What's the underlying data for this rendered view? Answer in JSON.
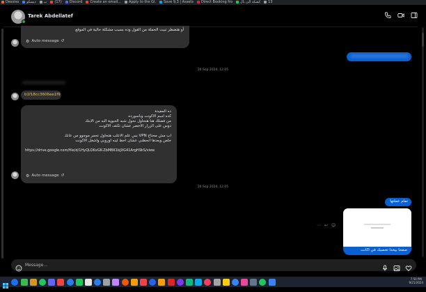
{
  "browser_tabs": [
    {
      "label": "Dessiso",
      "color": "#e36b2e"
    },
    {
      "label": "دیسکو",
      "color": "#3b82f6"
    },
    {
      "label": "ب",
      "color": "#9aa0a6"
    },
    {
      "label": "‏(17)",
      "color": "#ef4444"
    },
    {
      "label": "Discord",
      "color": "#5865f2"
    },
    {
      "label": "Create an email...",
      "color": "#ea4335"
    },
    {
      "label": "Apply to the Gi.",
      "color": "#9aa0a6"
    },
    {
      "label": "Save 9,3 | Assets",
      "color": "#0ea5e9"
    },
    {
      "label": "Direct Booking fro",
      "color": "#e11d48"
    },
    {
      "label": "كشكة الى نال",
      "color": "#22c55e"
    },
    {
      "label": "13",
      "color": "#9aa0a6"
    }
  ],
  "header": {
    "contact_name": "Tarek Abdellatef"
  },
  "messages": {
    "first_bubble_text": "أو هتضطر تبيت الحملة من القول وده بسبب مشكلة حالية في الموقع",
    "auto_message_label": "Auto message",
    "outgoing_blurred": "xxxxxxxxxxxxxxxxxxxxxxxxxxxxxxxxxxx",
    "timestamp_1": "20 Sep 2024, 12:05",
    "blurred_label": "xxxxxxxxxxxxxxxxxxx",
    "code_bubble": "b1f18cc3606ee1f9",
    "long_lines": [
      "ده المفيدة",
      "كده اسم الاكونت وباسورده",
      "من فضلك هنا هنحاول نحول شبه الحيوية البه من الابنك",
      "دوس على الزرار الاخضر عشان تكتف الاكونت",
      "",
      "اب مش محتاج VPN بس علم الاعلب هتحاول تحمر موجوو من عانك",
      "خلص وبعدها انحطني عشان اخط لينه اوروبي واشغل الاكونت",
      "",
      "https://drive.google.com/file/d/1HyQLOKxGK-ZbMBK1bJXG41ArgH9kS/view"
    ],
    "timestamp_2": "20 Sep 2024, 12:05",
    "reply_bubble": "تمام عملتها",
    "final_bubble": "صفحا بيخدا تخصبك في اكانت"
  },
  "composer": {
    "placeholder": "Message..."
  },
  "taskbar": {
    "time": "7:50 PM",
    "date": "9/21/2024",
    "icons": [
      "#1f6feb",
      "#3fb950",
      "#d29922",
      "#22c55e",
      "#6366f1",
      "#ef4444",
      "#2b7de9",
      "#22c55e",
      "#e4e4e4",
      "#2b7de9",
      "#9aa0a6",
      "#c084fc",
      "#ea580c",
      "#f59e0b",
      "#ef4444",
      "#2563eb",
      "#f59e0b",
      "#dc2626",
      "#7c3aed",
      "#10b981",
      "#0ea5e9",
      "#f43f5e",
      "#a3a3a3",
      "#facc15",
      "#3b82f6",
      "#ec4899",
      "#64748b",
      "#22c55e",
      "#3b82f6",
      "#f97316"
    ]
  }
}
